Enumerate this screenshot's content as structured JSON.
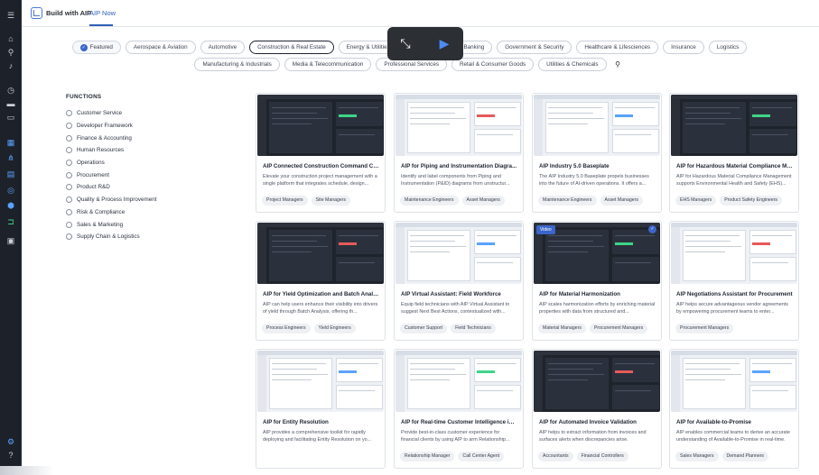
{
  "topbar": {
    "brand": "Build with AIP",
    "breadcrumb": "AIP Now"
  },
  "industries_row1": [
    {
      "label": "Featured",
      "selected": false,
      "featured": true
    },
    {
      "label": "Aerospace & Aviation"
    },
    {
      "label": "Automotive"
    },
    {
      "label": "Construction & Real Estate",
      "selected": true
    },
    {
      "label": "Energy & Utilities"
    },
    {
      "label": "Financial Services & Banking"
    },
    {
      "label": "Government & Security"
    },
    {
      "label": "Healthcare & Lifesciences"
    },
    {
      "label": "Insurance"
    },
    {
      "label": "Logistics"
    }
  ],
  "industries_row2": [
    {
      "label": "Manufacturing & Industrials"
    },
    {
      "label": "Media & Telecommunication"
    },
    {
      "label": "Professional Services"
    },
    {
      "label": "Retail & Consumer Goods"
    },
    {
      "label": "Utilities & Chemicals"
    }
  ],
  "functions": {
    "title": "FUNCTIONS",
    "items": [
      "Customer Service",
      "Developer Framework",
      "Finance & Accounting",
      "Human Resources",
      "Operations",
      "Procurement",
      "Product R&D",
      "Quality & Process Improvement",
      "Risk & Compliance",
      "Sales & Marketing",
      "Supply Chain & Logistics"
    ]
  },
  "cards": [
    {
      "title": "AIP Connected Construction Command Ce...",
      "desc": "Elevate your construction project management with a single platform that integrates schedule, design...",
      "tags": [
        "Project Managers",
        "Site Managers"
      ],
      "theme": "dark"
    },
    {
      "title": "AIP for Piping and Instrumentation Diagra...",
      "desc": "Identify and label components from Piping and Instrumentation (P&ID) diagrams from unstructur...",
      "tags": [
        "Maintenance Engineers",
        "Asset Managers"
      ],
      "theme": "light"
    },
    {
      "title": "AIP Industry 5.0 Baseplate",
      "desc": "The AIP Industry 5.0 Baseplate propels businesses into the future of AI-driven operations. It offers a...",
      "tags": [
        "Maintenance Engineers",
        "Asset Managers"
      ],
      "theme": "light"
    },
    {
      "title": "AIP for Hazardous Material Compliance Ma...",
      "desc": "AIP for Hazardous Material Compliance Management supports Environmental Health and Safety (EHS)...",
      "tags": [
        "EHS Managers",
        "Product Safety Engineers"
      ],
      "theme": "dark"
    },
    {
      "title": "AIP for Yield Optimization and Batch Analysis",
      "desc": "AIP can help users enhance their visibility into drivers of yield through Batch Analysis, offering th...",
      "tags": [
        "Process Engineers",
        "Yield Engineers"
      ],
      "theme": "dark"
    },
    {
      "title": "AIP Virtual Assistant: Field Workforce",
      "desc": "Equip field technicians with AIP Virtual Assistant to suggest Next Best Actions, contextualized with...",
      "tags": [
        "Customer Support",
        "Field Technicians"
      ],
      "theme": "light"
    },
    {
      "title": "AIP for Material Harmonization",
      "desc": "AIP scales harmonization efforts by enriching material properties with data from structured and...",
      "tags": [
        "Material Managers",
        "Procurement Managers"
      ],
      "theme": "dark",
      "video": "Video"
    },
    {
      "title": "AIP Negotiations Assistant for Procurement",
      "desc": "AIP helps secure advantageous vendor agreements by empowering procurement teams to enter...",
      "tags": [
        "Procurement Managers"
      ],
      "theme": "light"
    },
    {
      "title": "AIP for Entity Resolution",
      "desc": "AIP provides a comprehensive toolkit for rapidly deploying and facilitating Entity Resolution on yo...",
      "tags": [],
      "theme": "light"
    },
    {
      "title": "AIP for Real-time Customer Intelligence in ...",
      "desc": "Provide best-in-class customer experience for financial clients by using AIP to arm Relationship...",
      "tags": [
        "Relationship Manager",
        "Call Center Agent"
      ],
      "theme": "light"
    },
    {
      "title": "AIP for Automated Invoice Validation",
      "desc": "AIP helps to extract information from invoices and surfaces alerts when discrepancies arise.",
      "tags": [
        "Accountants",
        "Financial Controllers"
      ],
      "theme": "dark"
    },
    {
      "title": "AIP for Available-to-Promise",
      "desc": "AIP enables commercial teams to derive an accurate understanding of Available-to-Promise in real-time.",
      "tags": [
        "Sales Managers",
        "Demand Planners"
      ],
      "theme": "light"
    }
  ]
}
